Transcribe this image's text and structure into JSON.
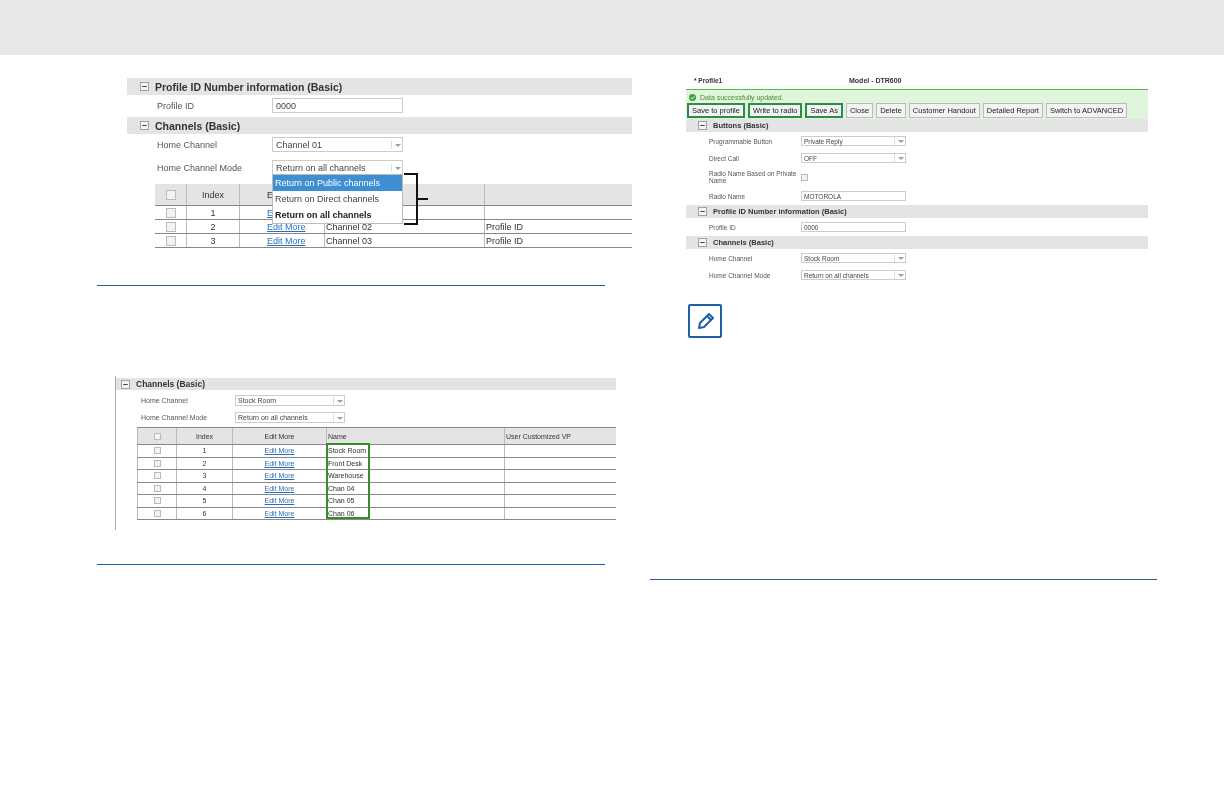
{
  "figure_1": {
    "sections": [
      {
        "title": "Profile ID Number information (Basic)",
        "expanded": true,
        "fields": [
          {
            "label": "Profile ID",
            "kind": "text",
            "value": "0000"
          }
        ]
      },
      {
        "title": "Channels (Basic)",
        "expanded": true,
        "fields": [
          {
            "label": "Home Channel",
            "kind": "select",
            "value": "Channel 01"
          },
          {
            "label": "Home Channel Mode",
            "kind": "select",
            "value": "Return on all channels"
          }
        ]
      }
    ],
    "dropdown": {
      "options": [
        {
          "label": "Return on Public channels",
          "selected": true,
          "current": false
        },
        {
          "label": "Return on Direct channels",
          "selected": false,
          "current": false
        },
        {
          "label": "Return on all channels",
          "selected": false,
          "current": true
        }
      ]
    },
    "table": {
      "all_checked": false,
      "columns": [
        "",
        "Index",
        "E",
        "",
        ""
      ],
      "rows": [
        {
          "checked": false,
          "index": "1",
          "edit": "E",
          "name": "",
          "column_5": ""
        },
        {
          "checked": false,
          "index": "2",
          "edit": "Edit More",
          "name": "Channel 02",
          "column_5": "Profile ID"
        },
        {
          "checked": false,
          "index": "3",
          "edit": "Edit More",
          "name": "Channel 03",
          "column_5": "Profile ID"
        }
      ]
    }
  },
  "figure_2": {
    "sections": [
      {
        "title": "Channels (Basic)",
        "expanded": true,
        "fields": [
          {
            "label": "Home Channel",
            "kind": "select",
            "value": "Stock Room"
          },
          {
            "label": "Home Channel Mode",
            "kind": "select",
            "value": "Return on all channels"
          }
        ]
      }
    ],
    "table": {
      "all_checked": false,
      "name_highlighted": true,
      "columns": [
        "",
        "Index",
        "Edit More",
        "Name",
        "User Customized VP"
      ],
      "rows": [
        {
          "checked": false,
          "index": "1",
          "edit": "Edit More",
          "name": "Stock Room"
        },
        {
          "checked": false,
          "index": "2",
          "edit": "Edit More",
          "name": "Front Desk"
        },
        {
          "checked": false,
          "index": "3",
          "edit": "Edit More",
          "name": "Warehouse"
        },
        {
          "checked": false,
          "index": "4",
          "edit": "Edit More",
          "name": "Chan 04"
        },
        {
          "checked": false,
          "index": "5",
          "edit": "Edit More",
          "name": "Chan 05"
        },
        {
          "checked": false,
          "index": "6",
          "edit": "Edit More",
          "name": "Chan 06"
        }
      ]
    }
  },
  "figure_3": {
    "profile": "* Profile1",
    "model": "Model - DTR600",
    "message": "Data successfully updated.",
    "buttons": [
      {
        "label": "Save to profile",
        "highlighted": true
      },
      {
        "label": "Write to radio",
        "highlighted": true
      },
      {
        "label": "Save As",
        "highlighted": true
      },
      {
        "label": "Close",
        "highlighted": false
      },
      {
        "label": "Delete",
        "highlighted": false
      },
      {
        "label": "Customer Handout",
        "highlighted": false
      },
      {
        "label": "Detailed Report",
        "highlighted": false
      },
      {
        "label": "Switch to ADVANCED",
        "highlighted": false
      }
    ],
    "sections": [
      {
        "title": "Buttons (Basic)",
        "expanded": true,
        "fields": [
          {
            "label": "Programmable Button",
            "kind": "select",
            "value": "Private Reply"
          },
          {
            "label": "Direct Call",
            "kind": "select",
            "value": "OFF"
          },
          {
            "label": "Radio Name Based on Private Name",
            "kind": "checkbox",
            "checked": false
          },
          {
            "label": "Radio Name",
            "kind": "text",
            "value": "MOTOROLA"
          }
        ]
      },
      {
        "title": "Profile ID Number information (Basic)",
        "expanded": true,
        "fields": [
          {
            "label": "Profile ID",
            "kind": "text",
            "value": "0000"
          }
        ]
      },
      {
        "title": "Channels (Basic)",
        "expanded": true,
        "fields": [
          {
            "label": "Home Channel",
            "kind": "select",
            "value": "Stock Room"
          },
          {
            "label": "Home Channel Mode",
            "kind": "select",
            "value": "Return on all channels"
          }
        ]
      }
    ]
  }
}
